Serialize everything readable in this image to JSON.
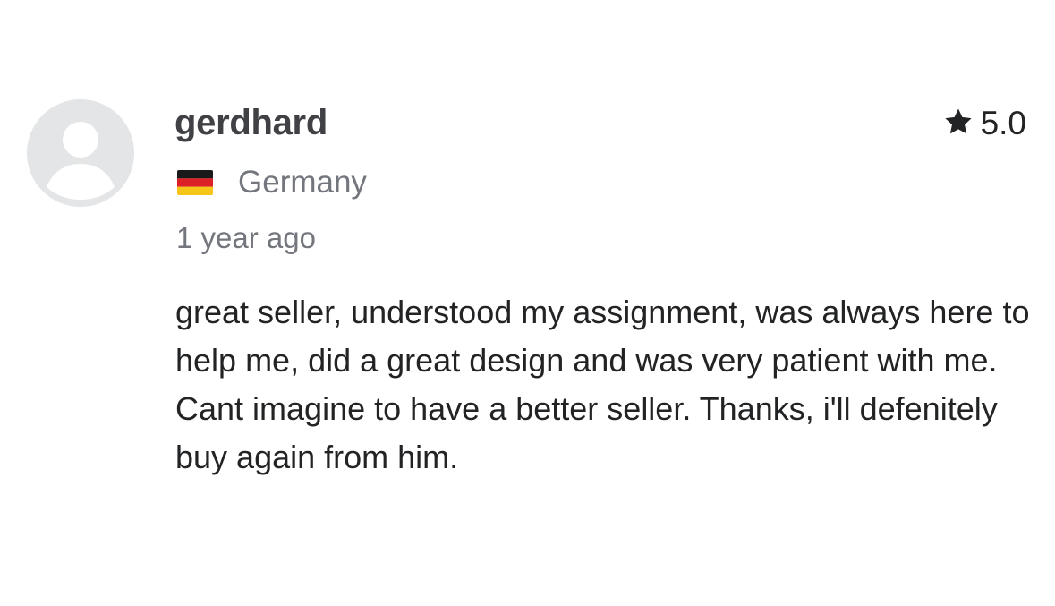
{
  "review": {
    "username": "gerdhard",
    "rating": "5.0",
    "country": "Germany",
    "country_flag": "flag-germany-icon",
    "time_ago": "1 year ago",
    "text": "great seller, understood my assignment, was always here to help me, did a great design and was very patient with me. Cant imagine to have a better seller. Thanks, i'll defenitely buy again from him."
  },
  "icons": {
    "avatar": "default-user-avatar-icon",
    "rating": "star-icon"
  },
  "colors": {
    "username": "#404145",
    "muted_text": "#74767e",
    "body_text": "#222325",
    "avatar_bg": "#e4e5e7",
    "avatar_fg": "#ffffff"
  }
}
